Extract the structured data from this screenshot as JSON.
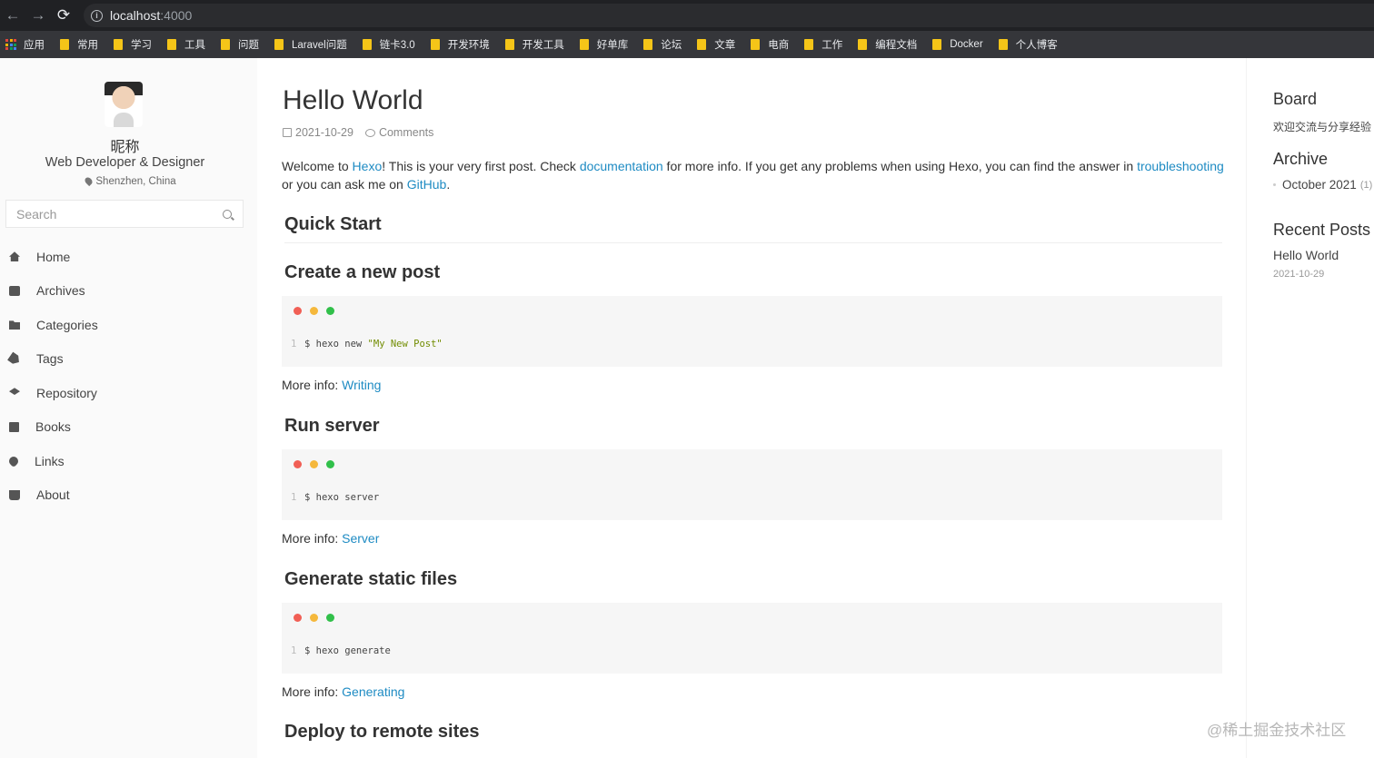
{
  "browser": {
    "url_host": "localhost",
    "url_port": ":4000",
    "bookmarks": [
      "应用",
      "常用",
      "学习",
      "工具",
      "问题",
      "Laravel问题",
      "链卡3.0",
      "开发环境",
      "开发工具",
      "好单库",
      "论坛",
      "文章",
      "电商",
      "工作",
      "编程文档",
      "Docker",
      "个人博客"
    ]
  },
  "sidebar": {
    "nickname": "昵称",
    "role": "Web Developer & Designer",
    "location": "Shenzhen, China",
    "search_placeholder": "Search",
    "menu": [
      {
        "label": "Home",
        "icon": "home-icon"
      },
      {
        "label": "Archives",
        "icon": "archive-icon"
      },
      {
        "label": "Categories",
        "icon": "folder-icon"
      },
      {
        "label": "Tags",
        "icon": "tag-icon"
      },
      {
        "label": "Repository",
        "icon": "repository-icon"
      },
      {
        "label": "Books",
        "icon": "book-icon"
      },
      {
        "label": "Links",
        "icon": "link-icon"
      },
      {
        "label": "About",
        "icon": "coffee-icon"
      }
    ]
  },
  "post": {
    "title": "Hello World",
    "date": "2021-10-29",
    "comments": "Comments",
    "intro": {
      "t1": "Welcome to ",
      "l1": "Hexo",
      "t2": "! This is your very first post. Check ",
      "l2": "documentation",
      "t3": " for more info. If you get any problems when using Hexo, you can find the answer in ",
      "l3": "troubleshooting",
      "t4": " or you can ask me on ",
      "l4": "GitHub",
      "t5": "."
    },
    "quick_start": "Quick Start",
    "more_info_label": "More info: ",
    "sections": [
      {
        "heading": "Create a new post",
        "line_no": "1",
        "cmd": "$ hexo new ",
        "cmd_str": "\"My New Post\"",
        "link": "Writing"
      },
      {
        "heading": "Run server",
        "line_no": "1",
        "cmd": "$ hexo server",
        "cmd_str": "",
        "link": "Server"
      },
      {
        "heading": "Generate static files",
        "line_no": "1",
        "cmd": "$ hexo generate",
        "cmd_str": "",
        "link": "Generating"
      }
    ],
    "deploy_heading": "Deploy to remote sites"
  },
  "rightbar": {
    "board_title": "Board",
    "board_text": "欢迎交流与分享经验",
    "archive_title": "Archive",
    "archive_item": "October 2021",
    "archive_count": "(1)",
    "recent_title": "Recent Posts",
    "recent_item": "Hello World",
    "recent_date": "2021-10-29"
  },
  "watermark": "@稀土掘金技术社区",
  "colors": {
    "link": "#1e8bc3",
    "dot_red": "#f15f55",
    "dot_yellow": "#f5b83c",
    "dot_green": "#31c04a"
  }
}
